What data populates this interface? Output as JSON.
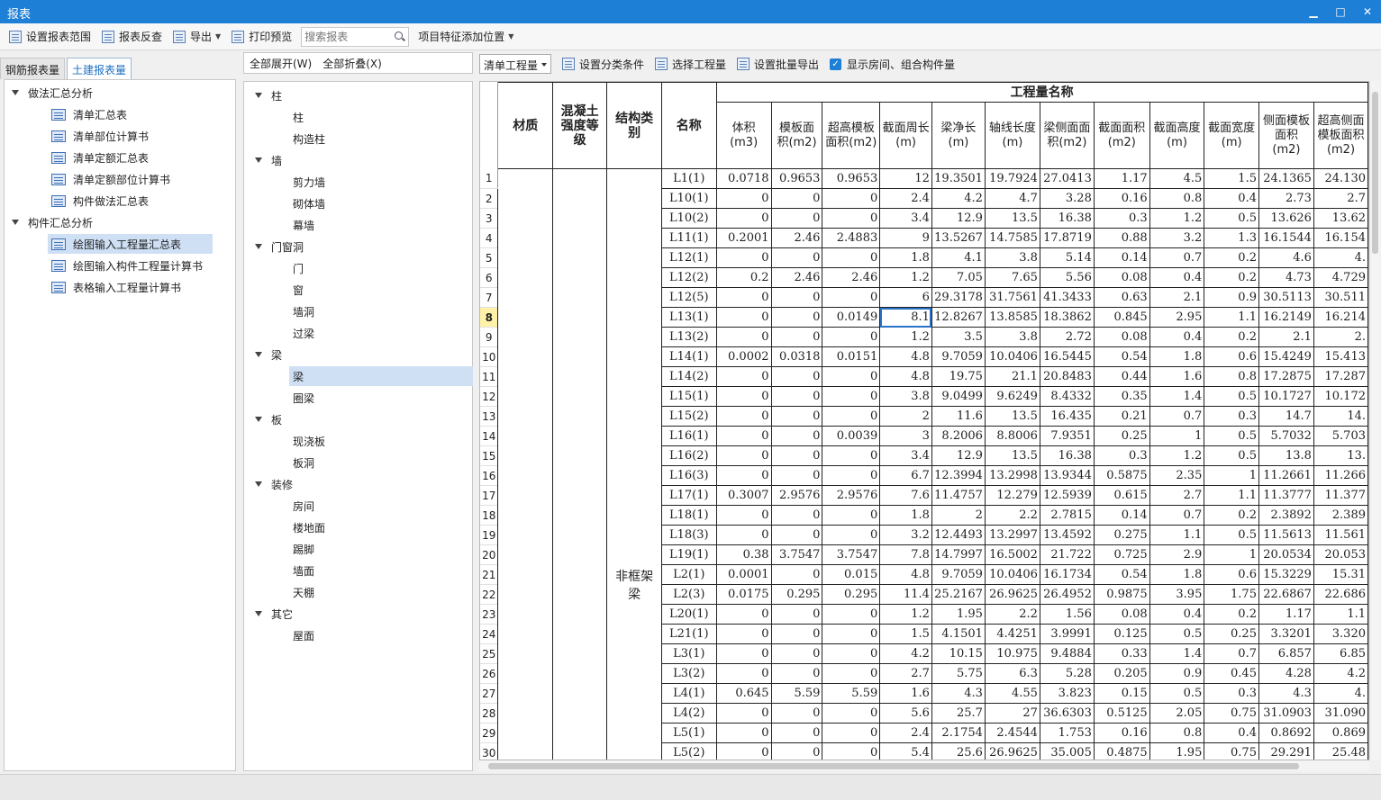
{
  "window": {
    "title": "报表"
  },
  "toolbar": {
    "set_range": "设置报表范围",
    "check": "报表反查",
    "export": "导出",
    "print_preview": "打印预览",
    "search_placeholder": "搜索报表",
    "add_feature": "项目特征添加位置"
  },
  "left_tabs": [
    "钢筋报表量",
    "土建报表量"
  ],
  "left_tree": {
    "g1": "做法汇总分析",
    "g1_items": [
      "清单汇总表",
      "清单部位计算书",
      "清单定额汇总表",
      "清单定额部位计算书",
      "构件做法汇总表"
    ],
    "g2": "构件汇总分析",
    "g2_items": [
      "绘图输入工程量汇总表",
      "绘图输入构件工程量计算书",
      "表格输入工程量计算书"
    ]
  },
  "middle": {
    "expand_all": "全部展开(W)",
    "collapse_all": "全部折叠(X)",
    "tree": [
      {
        "label": "柱",
        "children": [
          "柱",
          "构造柱"
        ]
      },
      {
        "label": "墙",
        "children": [
          "剪力墙",
          "砌体墙",
          "幕墙"
        ]
      },
      {
        "label": "门窗洞",
        "children": [
          "门",
          "窗",
          "墙洞",
          "过梁"
        ]
      },
      {
        "label": "梁",
        "children": [
          "梁",
          "圈梁"
        ]
      },
      {
        "label": "板",
        "children": [
          "现浇板",
          "板洞"
        ]
      },
      {
        "label": "装修",
        "children": [
          "房间",
          "楼地面",
          "踢脚",
          "墙面",
          "天棚"
        ]
      },
      {
        "label": "其它",
        "children": [
          "屋面"
        ]
      }
    ]
  },
  "right_bar": {
    "select": "清单工程量",
    "classify": "设置分类条件",
    "choose_qty": "选择工程量",
    "batch_export": "设置批量导出",
    "show_rooms": "显示房间、组合构件量"
  },
  "grid": {
    "group_header": "工程量名称",
    "fixed_headers": [
      "材质",
      "混凝土强度等级",
      "结构类别",
      "名称"
    ],
    "headers": [
      "体积(m3)",
      "模板面积(m2)",
      "超高模板面积(m2)",
      "截面周长(m)",
      "梁净长(m)",
      "轴线长度(m)",
      "梁侧面面积(m2)",
      "截面面积(m2)",
      "截面高度(m)",
      "截面宽度(m)",
      "侧面模板面积(m2)",
      "超高侧面模板面积(m2)"
    ],
    "struct_label": "非框架梁",
    "rows": [
      [
        "1",
        "L1(1)",
        "0.0718",
        "0.9653",
        "0.9653",
        "12",
        "19.3501",
        "19.7924",
        "27.0413",
        "1.17",
        "4.5",
        "1.5",
        "24.1365",
        "24.130"
      ],
      [
        "2",
        "L10(1)",
        "0",
        "0",
        "0",
        "2.4",
        "4.2",
        "4.7",
        "3.28",
        "0.16",
        "0.8",
        "0.4",
        "2.73",
        "2.7"
      ],
      [
        "3",
        "L10(2)",
        "0",
        "0",
        "0",
        "3.4",
        "12.9",
        "13.5",
        "16.38",
        "0.3",
        "1.2",
        "0.5",
        "13.626",
        "13.62"
      ],
      [
        "4",
        "L11(1)",
        "0.2001",
        "2.46",
        "2.4883",
        "9",
        "13.5267",
        "14.7585",
        "17.8719",
        "0.88",
        "3.2",
        "1.3",
        "16.1544",
        "16.154"
      ],
      [
        "5",
        "L12(1)",
        "0",
        "0",
        "0",
        "1.8",
        "4.1",
        "3.8",
        "5.14",
        "0.14",
        "0.7",
        "0.2",
        "4.6",
        "4."
      ],
      [
        "6",
        "L12(2)",
        "0.2",
        "2.46",
        "2.46",
        "1.2",
        "7.05",
        "7.65",
        "5.56",
        "0.08",
        "0.4",
        "0.2",
        "4.73",
        "4.729"
      ],
      [
        "7",
        "L12(5)",
        "0",
        "0",
        "0",
        "6",
        "29.3178",
        "31.7561",
        "41.3433",
        "0.63",
        "2.1",
        "0.9",
        "30.5113",
        "30.511"
      ],
      [
        "8",
        "L13(1)",
        "0",
        "0",
        "0.0149",
        "8.1",
        "12.8267",
        "13.8585",
        "18.3862",
        "0.845",
        "2.95",
        "1.1",
        "16.2149",
        "16.214"
      ],
      [
        "9",
        "L13(2)",
        "0",
        "0",
        "0",
        "1.2",
        "3.5",
        "3.8",
        "2.72",
        "0.08",
        "0.4",
        "0.2",
        "2.1",
        "2."
      ],
      [
        "10",
        "L14(1)",
        "0.0002",
        "0.0318",
        "0.0151",
        "4.8",
        "9.7059",
        "10.0406",
        "16.5445",
        "0.54",
        "1.8",
        "0.6",
        "15.4249",
        "15.413"
      ],
      [
        "11",
        "L14(2)",
        "0",
        "0",
        "0",
        "4.8",
        "19.75",
        "21.1",
        "20.8483",
        "0.44",
        "1.6",
        "0.8",
        "17.2875",
        "17.287"
      ],
      [
        "12",
        "L15(1)",
        "0",
        "0",
        "0",
        "3.8",
        "9.0499",
        "9.6249",
        "8.4332",
        "0.35",
        "1.4",
        "0.5",
        "10.1727",
        "10.172"
      ],
      [
        "13",
        "L15(2)",
        "0",
        "0",
        "0",
        "2",
        "11.6",
        "13.5",
        "16.435",
        "0.21",
        "0.7",
        "0.3",
        "14.7",
        "14."
      ],
      [
        "14",
        "L16(1)",
        "0",
        "0",
        "0.0039",
        "3",
        "8.2006",
        "8.8006",
        "7.9351",
        "0.25",
        "1",
        "0.5",
        "5.7032",
        "5.703"
      ],
      [
        "15",
        "L16(2)",
        "0",
        "0",
        "0",
        "3.4",
        "12.9",
        "13.5",
        "16.38",
        "0.3",
        "1.2",
        "0.5",
        "13.8",
        "13."
      ],
      [
        "16",
        "L16(3)",
        "0",
        "0",
        "0",
        "6.7",
        "12.3994",
        "13.2998",
        "13.9344",
        "0.5875",
        "2.35",
        "1",
        "11.2661",
        "11.266"
      ],
      [
        "17",
        "L17(1)",
        "0.3007",
        "2.9576",
        "2.9576",
        "7.6",
        "11.4757",
        "12.279",
        "12.5939",
        "0.615",
        "2.7",
        "1.1",
        "11.3777",
        "11.377"
      ],
      [
        "18",
        "L18(1)",
        "0",
        "0",
        "0",
        "1.8",
        "2",
        "2.2",
        "2.7815",
        "0.14",
        "0.7",
        "0.2",
        "2.3892",
        "2.389"
      ],
      [
        "19",
        "L18(3)",
        "0",
        "0",
        "0",
        "3.2",
        "12.4493",
        "13.2997",
        "13.4592",
        "0.275",
        "1.1",
        "0.5",
        "11.5613",
        "11.561"
      ],
      [
        "20",
        "L19(1)",
        "0.38",
        "3.7547",
        "3.7547",
        "7.8",
        "14.7997",
        "16.5002",
        "21.722",
        "0.725",
        "2.9",
        "1",
        "20.0534",
        "20.053"
      ],
      [
        "21",
        "L2(1)",
        "0.0001",
        "0",
        "0.015",
        "4.8",
        "9.7059",
        "10.0406",
        "16.1734",
        "0.54",
        "1.8",
        "0.6",
        "15.3229",
        "15.31"
      ],
      [
        "22",
        "L2(3)",
        "0.0175",
        "0.295",
        "0.295",
        "11.4",
        "25.2167",
        "26.9625",
        "26.4952",
        "0.9875",
        "3.95",
        "1.75",
        "22.6867",
        "22.686"
      ],
      [
        "23",
        "L20(1)",
        "0",
        "0",
        "0",
        "1.2",
        "1.95",
        "2.2",
        "1.56",
        "0.08",
        "0.4",
        "0.2",
        "1.17",
        "1.1"
      ],
      [
        "24",
        "L21(1)",
        "0",
        "0",
        "0",
        "1.5",
        "4.1501",
        "4.4251",
        "3.9991",
        "0.125",
        "0.5",
        "0.25",
        "3.3201",
        "3.320"
      ],
      [
        "25",
        "L3(1)",
        "0",
        "0",
        "0",
        "4.2",
        "10.15",
        "10.975",
        "9.4884",
        "0.33",
        "1.4",
        "0.7",
        "6.857",
        "6.85"
      ],
      [
        "26",
        "L3(2)",
        "0",
        "0",
        "0",
        "2.7",
        "5.75",
        "6.3",
        "5.28",
        "0.205",
        "0.9",
        "0.45",
        "4.28",
        "4.2"
      ],
      [
        "27",
        "L4(1)",
        "0.645",
        "5.59",
        "5.59",
        "1.6",
        "4.3",
        "4.55",
        "3.823",
        "0.15",
        "0.5",
        "0.3",
        "4.3",
        "4."
      ],
      [
        "28",
        "L4(2)",
        "0",
        "0",
        "0",
        "5.6",
        "25.7",
        "27",
        "36.6303",
        "0.5125",
        "2.05",
        "0.75",
        "31.0903",
        "31.090"
      ],
      [
        "29",
        "L5(1)",
        "0",
        "0",
        "0",
        "2.4",
        "2.1754",
        "2.4544",
        "1.753",
        "0.16",
        "0.8",
        "0.4",
        "0.8692",
        "0.869"
      ],
      [
        "30",
        "L5(2)",
        "0",
        "0",
        "0",
        "5.4",
        "25.6",
        "26.9625",
        "35.005",
        "0.4875",
        "1.95",
        "0.75",
        "29.291",
        "25.48"
      ]
    ]
  },
  "colors": {
    "accent": "#1e7fd6",
    "selected": "#cfe0f5",
    "current_row": "#fff2a8"
  }
}
